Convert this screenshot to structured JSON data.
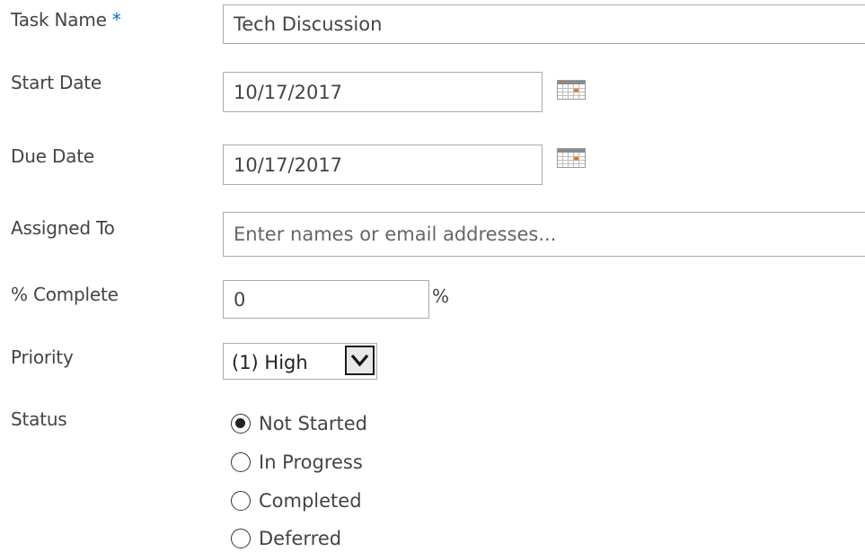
{
  "fields": {
    "task_name": {
      "label": "Task Name",
      "required_mark": "*",
      "value": "Tech Discussion"
    },
    "start_date": {
      "label": "Start Date",
      "value": "10/17/2017",
      "icon": "calendar-icon"
    },
    "due_date": {
      "label": "Due Date",
      "value": "10/17/2017",
      "icon": "calendar-icon"
    },
    "assigned_to": {
      "label": "Assigned To",
      "value": "",
      "placeholder": "Enter names or email addresses..."
    },
    "percent_complete": {
      "label": "% Complete",
      "value": "0",
      "unit": "%"
    },
    "priority": {
      "label": "Priority",
      "selected": "(1) High",
      "icon": "chevron-down-icon"
    },
    "status": {
      "label": "Status",
      "options": [
        {
          "label": "Not Started",
          "checked": true
        },
        {
          "label": "In Progress",
          "checked": false
        },
        {
          "label": "Completed",
          "checked": false
        },
        {
          "label": "Deferred",
          "checked": false
        }
      ]
    }
  },
  "colors": {
    "required_mark": "#0072c6",
    "label_text": "#444444",
    "input_border": "#ababab",
    "calendar_accent": "#e87722"
  }
}
